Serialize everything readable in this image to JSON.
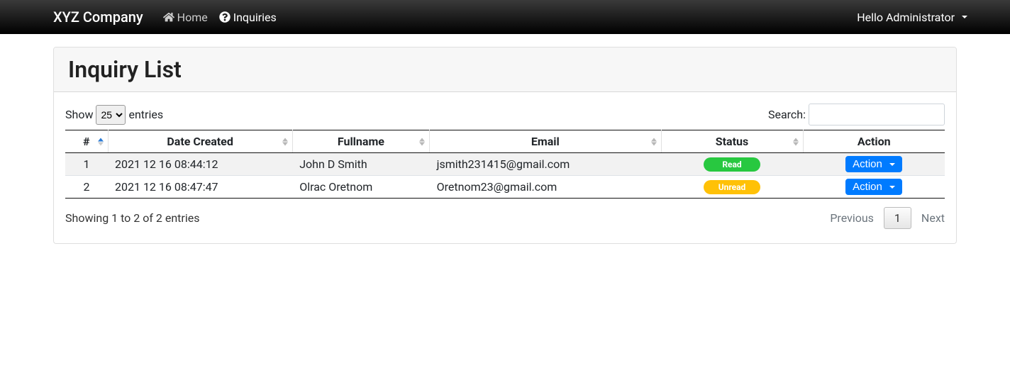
{
  "navbar": {
    "brand": "XYZ Company",
    "home_label": "Home",
    "inquiries_label": "Inquiries",
    "user_greeting": "Hello Administrator"
  },
  "page": {
    "title": "Inquiry List"
  },
  "table": {
    "show_label_prefix": "Show",
    "show_label_suffix": "entries",
    "show_value": "25",
    "search_label": "Search:",
    "columns": {
      "num": "#",
      "date_created": "Date Created",
      "fullname": "Fullname",
      "email": "Email",
      "status": "Status",
      "action": "Action"
    },
    "rows": [
      {
        "num": "1",
        "date_created": "2021 12 16 08:44:12",
        "fullname": "John D Smith",
        "email": "jsmith231415@gmail.com",
        "status": "Read",
        "status_class": "success",
        "action_label": "Action"
      },
      {
        "num": "2",
        "date_created": "2021 12 16 08:47:47",
        "fullname": "Olrac Oretnom",
        "email": "Oretnom23@gmail.com",
        "status": "Unread",
        "status_class": "warning",
        "action_label": "Action"
      }
    ],
    "info": "Showing 1 to 2 of 2 entries",
    "pagination": {
      "previous": "Previous",
      "current": "1",
      "next": "Next"
    }
  }
}
